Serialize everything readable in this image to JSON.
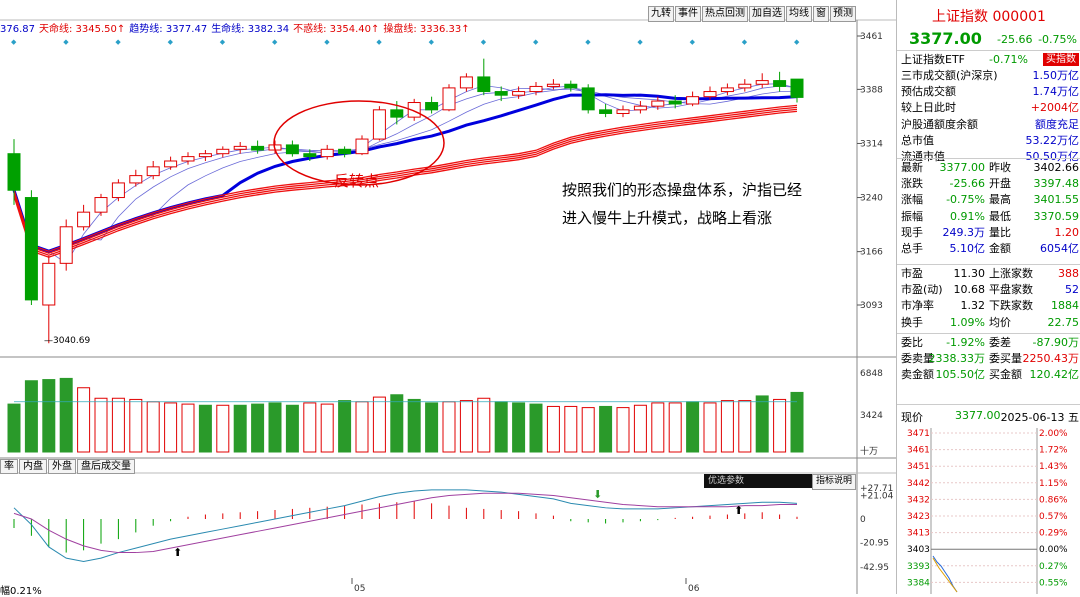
{
  "legend": [
    {
      "text": "376.87",
      "color": "#0000c8"
    },
    {
      "text": "天命线: 3345.50↑",
      "color": "#e00000"
    },
    {
      "text": "趋势线: 3377.47",
      "color": "#0000c8"
    },
    {
      "text": "生命线: 3382.34",
      "color": "#0000c8"
    },
    {
      "text": "不惑线: 3354.40↑",
      "color": "#e00000"
    },
    {
      "text": "操盘线: 3336.33↑",
      "color": "#e00000"
    }
  ],
  "toolbar": [
    "九转",
    "事件",
    "热点回测",
    "加自选",
    "均线",
    "窗",
    "预测"
  ],
  "price_axis": [
    "3461",
    "3388",
    "3314",
    "3240",
    "3166",
    "3093"
  ],
  "volume_axis": [
    "6848",
    "3424",
    "十万"
  ],
  "low_label": "3040.69",
  "annotation_reversal": "反转点",
  "commentary": [
    "按照我们的形态操盘体系，沪指已经",
    "进入慢牛上升模式，战略上看涨"
  ],
  "bottom_tabs": [
    "率",
    "内盘",
    "外盘",
    "盘后成交量"
  ],
  "indicator_buttons": [
    "优选参数",
    "指标说明"
  ],
  "indicator_axis": [
    "27.71",
    "21.04",
    "0",
    "-20.95",
    "-42.95"
  ],
  "date_ticks": [
    "05",
    "06"
  ],
  "bottom_left": "幅0.21%",
  "colors": {
    "up": "#e00000",
    "down": "#00a000",
    "ma_blue": "#0000dd",
    "accent": "#e00000"
  },
  "quote": {
    "title": "上证指数 000001",
    "price": "3377.00",
    "change": "-25.66",
    "change_pct": "-0.75%",
    "etf_label": "上证指数ETF",
    "etf_pct": "-0.71%",
    "buy_btn": "买指数",
    "stats_a": [
      {
        "k": "三市成交额(沪深京)",
        "v": "1.50万亿",
        "c": "blue"
      },
      {
        "k": "预估成交额",
        "v": "1.74万亿",
        "c": "blue"
      },
      {
        "k": "较上日此时",
        "v": "+2004亿",
        "c": "red"
      },
      {
        "k": "沪股通额度余额",
        "v": "额度充足",
        "c": "blue"
      },
      {
        "k": "总市值",
        "v": "53.22万亿",
        "c": "blue"
      },
      {
        "k": "流通市值",
        "v": "50.50万亿",
        "c": "blue"
      }
    ],
    "stats_b": [
      {
        "k1": "最新",
        "v1": "3377.00",
        "c1": "green",
        "k2": "昨收",
        "v2": "3402.66",
        "c2": ""
      },
      {
        "k1": "涨跌",
        "v1": "-25.66",
        "c1": "green",
        "k2": "开盘",
        "v2": "3397.48",
        "c2": "green"
      },
      {
        "k1": "涨幅",
        "v1": "-0.75%",
        "c1": "green",
        "k2": "最高",
        "v2": "3401.55",
        "c2": "green"
      },
      {
        "k1": "振幅",
        "v1": "0.91%",
        "c1": "green",
        "k2": "最低",
        "v2": "3370.59",
        "c2": "green"
      },
      {
        "k1": "现手",
        "v1": "249.3万",
        "c1": "blue",
        "k2": "量比",
        "v2": "1.20",
        "c2": "red"
      },
      {
        "k1": "总手",
        "v1": "5.10亿",
        "c1": "blue",
        "k2": "金额",
        "v2": "6054亿",
        "c2": "blue"
      }
    ],
    "stats_c": [
      {
        "k1": "市盈",
        "v1": "11.30",
        "c1": "",
        "k2": "上涨家数",
        "v2": "388",
        "c2": "red"
      },
      {
        "k1": "市盈(动)",
        "v1": "10.68",
        "c1": "",
        "k2": "平盘家数",
        "v2": "52",
        "c2": "blue"
      },
      {
        "k1": "市净率",
        "v1": "1.32",
        "c1": "",
        "k2": "下跌家数",
        "v2": "1884",
        "c2": "green"
      },
      {
        "k1": "换手",
        "v1": "1.09%",
        "c1": "green",
        "k2": "均价",
        "v2": "22.75",
        "c2": "green"
      }
    ],
    "stats_d": [
      {
        "k1": "委比",
        "v1": "-1.92%",
        "c1": "green",
        "k2": "委差",
        "v2": "-87.90万",
        "c2": "green"
      },
      {
        "k1": "委卖量",
        "v1": "2338.33万",
        "c1": "green",
        "k2": "委买量",
        "v2": "2250.43万",
        "c2": "red"
      },
      {
        "k1": "卖金额",
        "v1": "105.50亿",
        "c1": "green",
        "k2": "买金额",
        "v2": "120.42亿",
        "c2": "green"
      }
    ],
    "intraday_label": "现价",
    "intraday_price": "3377.00",
    "intraday_date": "2025-06-13 五",
    "intraday_left_axis": [
      "3471",
      "3461",
      "3451",
      "3442",
      "3432",
      "3423",
      "3413",
      "3403",
      "3393",
      "3384"
    ],
    "intraday_right_axis": [
      "2.00%",
      "1.72%",
      "1.43%",
      "1.15%",
      "0.86%",
      "0.57%",
      "0.29%",
      "0.00%",
      "0.27%",
      "0.55%"
    ]
  },
  "chart_data": {
    "type": "candlestick",
    "candles": [
      [
        3300,
        3250,
        3320,
        3230
      ],
      [
        3240,
        3100,
        3250,
        3093
      ],
      [
        3093,
        3150,
        3160,
        3040.69
      ],
      [
        3150,
        3200,
        3210,
        3140
      ],
      [
        3200,
        3220,
        3230,
        3195
      ],
      [
        3220,
        3240,
        3245,
        3215
      ],
      [
        3240,
        3260,
        3265,
        3235
      ],
      [
        3260,
        3270,
        3278,
        3255
      ],
      [
        3270,
        3282,
        3290,
        3265
      ],
      [
        3282,
        3290,
        3296,
        3278
      ],
      [
        3290,
        3296,
        3302,
        3285
      ],
      [
        3296,
        3300,
        3305,
        3290
      ],
      [
        3300,
        3306,
        3310,
        3295
      ],
      [
        3306,
        3310,
        3316,
        3300
      ],
      [
        3310,
        3305,
        3318,
        3300
      ],
      [
        3305,
        3312,
        3318,
        3300
      ],
      [
        3312,
        3300,
        3318,
        3296
      ],
      [
        3300,
        3296,
        3306,
        3290
      ],
      [
        3296,
        3306,
        3312,
        3292
      ],
      [
        3306,
        3300,
        3310,
        3295
      ],
      [
        3300,
        3320,
        3325,
        3298
      ],
      [
        3320,
        3360,
        3365,
        3318
      ],
      [
        3360,
        3350,
        3372,
        3340
      ],
      [
        3350,
        3370,
        3375,
        3345
      ],
      [
        3370,
        3360,
        3378,
        3355
      ],
      [
        3360,
        3390,
        3395,
        3358
      ],
      [
        3390,
        3405,
        3410,
        3385
      ],
      [
        3405,
        3385,
        3430,
        3380
      ],
      [
        3385,
        3380,
        3392,
        3372
      ],
      [
        3380,
        3385,
        3392,
        3375
      ],
      [
        3385,
        3392,
        3398,
        3380
      ],
      [
        3392,
        3395,
        3402,
        3388
      ],
      [
        3395,
        3390,
        3400,
        3385
      ],
      [
        3390,
        3360,
        3395,
        3355
      ],
      [
        3360,
        3355,
        3368,
        3350
      ],
      [
        3355,
        3360,
        3366,
        3350
      ],
      [
        3360,
        3365,
        3372,
        3355
      ],
      [
        3365,
        3372,
        3378,
        3360
      ],
      [
        3372,
        3368,
        3380,
        3362
      ],
      [
        3368,
        3378,
        3385,
        3365
      ],
      [
        3378,
        3385,
        3392,
        3374
      ],
      [
        3385,
        3390,
        3396,
        3380
      ],
      [
        3390,
        3395,
        3402,
        3385
      ],
      [
        3395,
        3400,
        3410,
        3390
      ],
      [
        3400,
        3392,
        3412,
        3385
      ],
      [
        3402,
        3377,
        3402,
        3370
      ]
    ],
    "volumes": [
      4100,
      6100,
      6200,
      6300,
      5500,
      4600,
      4600,
      4500,
      4300,
      4200,
      4100,
      4000,
      4000,
      4000,
      4100,
      4200,
      4000,
      4200,
      4100,
      4400,
      4300,
      4700,
      4900,
      4500,
      4200,
      4300,
      4400,
      4600,
      4300,
      4200,
      4100,
      3900,
      3900,
      3800,
      3900,
      3800,
      4000,
      4200,
      4200,
      4300,
      4200,
      4400,
      4400,
      4800,
      4500,
      5100
    ],
    "volume_down": [
      1,
      1,
      1,
      1,
      0,
      0,
      0,
      0,
      0,
      0,
      0,
      1,
      0,
      1,
      1,
      1,
      1,
      0,
      0,
      1,
      0,
      0,
      1,
      1,
      1,
      0,
      0,
      0,
      1,
      1,
      1,
      0,
      0,
      0,
      1,
      0,
      0,
      0,
      0,
      1,
      0,
      0,
      0,
      1,
      0,
      1
    ],
    "macd_bars": [
      -8,
      -15,
      -25,
      -30,
      -28,
      -22,
      -18,
      -12,
      -6,
      -2,
      2,
      4,
      5,
      6,
      7,
      8,
      9,
      10,
      11,
      12,
      13,
      14,
      15,
      16,
      14,
      12,
      10,
      9,
      8,
      7,
      5,
      3,
      -2,
      -3,
      -4,
      -3,
      -2,
      -1,
      1,
      2,
      3,
      4,
      5,
      6,
      4,
      2
    ],
    "dif": [
      10,
      -5,
      -25,
      -35,
      -38,
      -35,
      -30,
      -26,
      -22,
      -18,
      -15,
      -12,
      -9,
      -6,
      -3,
      0,
      3,
      6,
      9,
      12,
      16,
      20,
      23,
      25,
      26,
      26,
      26,
      25,
      24,
      22,
      20,
      18,
      14,
      12,
      10,
      9,
      9,
      9,
      10,
      11,
      12,
      13,
      14,
      15,
      15,
      14
    ],
    "dea": [
      5,
      0,
      -10,
      -18,
      -24,
      -28,
      -30,
      -30,
      -29,
      -26,
      -23,
      -20,
      -17,
      -14,
      -11,
      -8,
      -5,
      -2,
      1,
      4,
      7,
      10,
      13,
      16,
      19,
      21,
      22,
      23,
      23,
      23,
      22,
      21,
      19,
      17,
      15,
      13,
      12,
      11,
      11,
      11,
      11,
      11,
      12,
      12,
      13,
      13
    ]
  }
}
